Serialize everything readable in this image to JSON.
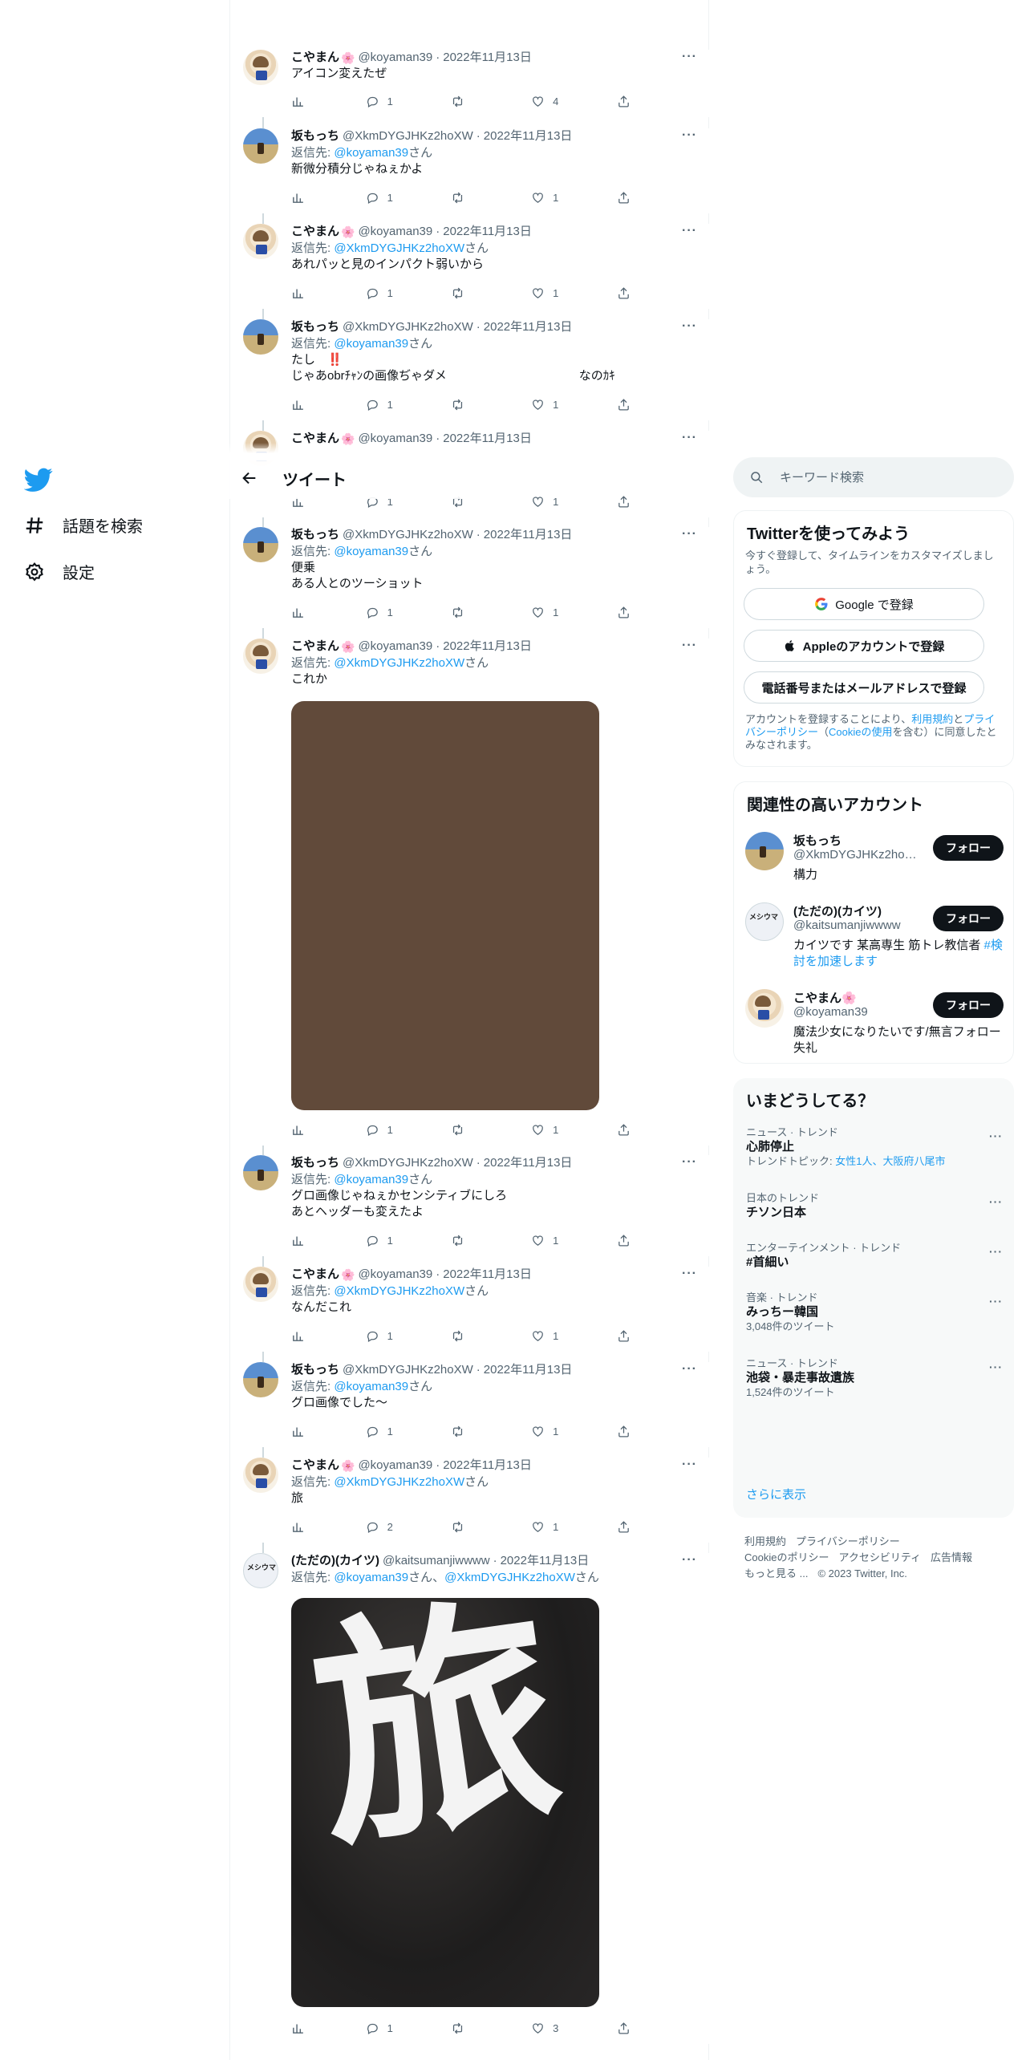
{
  "app": {
    "brand_color": "#1d9bf0"
  },
  "nav": {
    "logo": "twitter-bird-icon",
    "explore_label": "話題を検索",
    "settings_label": "設定"
  },
  "header": {
    "title": "ツイート"
  },
  "tweets": [
    {
      "name": "こやまん",
      "flower": "🌸",
      "handle": "@koyaman39",
      "date": "2022年11月13日",
      "reply_prefix": "",
      "reply_to": "",
      "reply_suffix": "",
      "text": "アイコン変えたぜ",
      "replies": "1",
      "retweets": "",
      "likes": "4"
    },
    {
      "name": "坂もっち",
      "flower": "",
      "handle": "@XkmDYGJHKz2hoXW",
      "date": "2022年11月13日",
      "reply_prefix": "返信先: ",
      "reply_to": "@koyaman39",
      "reply_suffix": "さん",
      "text": "新微分積分じゃねぇかよ",
      "replies": "1",
      "retweets": "",
      "likes": "1"
    },
    {
      "name": "こやまん",
      "flower": "🌸",
      "handle": "@koyaman39",
      "date": "2022年11月13日",
      "reply_prefix": "返信先: ",
      "reply_to": "@XkmDYGJHKz2hoXW",
      "reply_suffix": "さん",
      "text": "あれパッと見のインパクト弱いから",
      "replies": "1",
      "retweets": "",
      "likes": "1"
    },
    {
      "name": "坂もっち",
      "flower": "",
      "handle": "@XkmDYGJHKz2hoXW",
      "date": "2022年11月13日",
      "reply_prefix": "返信先: ",
      "reply_to": "@koyaman39",
      "reply_suffix": "さん",
      "text": "たし　‼️\nじゃあobrﾁｬﾝの画像ぢゃダメ　　　　　　　　　　　なのｶｷ",
      "replies": "1",
      "retweets": "",
      "likes": "1"
    },
    {
      "name": "こやまん",
      "flower": "🌸",
      "handle": "@koyaman39",
      "date": "2022年11月13日",
      "reply_prefix": "",
      "reply_to": "",
      "reply_suffix": "",
      "text": "",
      "replies": "1",
      "retweets": "",
      "likes": "1"
    },
    {
      "name": "坂もっち",
      "flower": "",
      "handle": "@XkmDYGJHKz2hoXW",
      "date": "2022年11月13日",
      "reply_prefix": "返信先: ",
      "reply_to": "@koyaman39",
      "reply_suffix": "さん",
      "text": "便乗\nある人とのツーショット",
      "replies": "1",
      "retweets": "",
      "likes": "1"
    },
    {
      "name": "こやまん",
      "flower": "🌸",
      "handle": "@koyaman39",
      "date": "2022年11月13日",
      "reply_prefix": "返信先: ",
      "reply_to": "@XkmDYGJHKz2hoXW",
      "reply_suffix": "さん",
      "text": "これか",
      "replies": "1",
      "retweets": "",
      "likes": "1"
    },
    {
      "name": "坂もっち",
      "flower": "",
      "handle": "@XkmDYGJHKz2hoXW",
      "date": "2022年11月13日",
      "reply_prefix": "返信先: ",
      "reply_to": "@koyaman39",
      "reply_suffix": "さん",
      "text": "グロ画像じゃねぇかセンシティブにしろ\nあとヘッダーも変えたよ",
      "replies": "1",
      "retweets": "",
      "likes": "1"
    },
    {
      "name": "こやまん",
      "flower": "🌸",
      "handle": "@koyaman39",
      "date": "2022年11月13日",
      "reply_prefix": "返信先: ",
      "reply_to": "@XkmDYGJHKz2hoXW",
      "reply_suffix": "さん",
      "text": "なんだこれ",
      "replies": "1",
      "retweets": "",
      "likes": "1"
    },
    {
      "name": "坂もっち",
      "flower": "",
      "handle": "@XkmDYGJHKz2hoXW",
      "date": "2022年11月13日",
      "reply_prefix": "返信先: ",
      "reply_to": "@koyaman39",
      "reply_suffix": "さん",
      "text": "グロ画像でした〜",
      "replies": "1",
      "retweets": "",
      "likes": "1"
    },
    {
      "name": "こやまん",
      "flower": "🌸",
      "handle": "@koyaman39",
      "date": "2022年11月13日",
      "reply_prefix": "返信先: ",
      "reply_to": "@XkmDYGJHKz2hoXW",
      "reply_suffix": "さん",
      "text": "旅",
      "replies": "2",
      "retweets": "",
      "likes": "1"
    },
    {
      "name": "(ただの)(カイツ)",
      "flower": "",
      "handle": "@kaitsumanjiwwww",
      "date": "2022年11月13日",
      "reply_prefix": "返信先: ",
      "reply_to": "@koyaman39",
      "reply_suffix": "さん、",
      "reply_to2": "@XkmDYGJHKz2hoXW",
      "reply_suffix2": "さん",
      "text": "",
      "replies": "1",
      "retweets": "",
      "likes": "3",
      "image_text": "旅"
    }
  ],
  "search": {
    "placeholder": "キーワード検索"
  },
  "signup": {
    "title": "Twitterを使ってみよう",
    "subtitle": "今すぐ登録して、タイムラインをカスタマイズしましょう。",
    "google": "Google で登録",
    "apple": "Appleのアカウントで登録",
    "phone": "電話番号またはメールアドレスで登録",
    "legal_1": "アカウントを登録することにより、",
    "legal_terms": "利用規約",
    "legal_2": "と",
    "legal_privacy": "プライバシーポリシー",
    "legal_3": "（",
    "legal_cookie": "Cookieの使用",
    "legal_4": "を含む）に同意したとみなされます。"
  },
  "related": {
    "title": "関連性の高いアカウント",
    "follow_label": "フォロー",
    "accounts": [
      {
        "name": "坂もっち",
        "handle": "@XkmDYGJHKz2hoXW",
        "bio": "構力",
        "bio_link": ""
      },
      {
        "name": "(ただの)(カイツ)",
        "handle": "@kaitsumanjiwwww",
        "bio": "カイツです 某高専生 筋トレ教信者 ",
        "bio_link": "#検討を加速します"
      },
      {
        "name": "こやまん🌸",
        "handle": "@koyaman39",
        "bio": "魔法少女になりたいです/無言フォロー失礼",
        "bio_link": ""
      }
    ]
  },
  "trends": {
    "title": "いまどうしてる？",
    "items": [
      {
        "category": "ニュース · トレンド",
        "topic": "心肺停止",
        "meta_prefix": "トレンドトピック: ",
        "meta_link": "女性1人、大阪府八尾市",
        "meta": ""
      },
      {
        "category": "日本のトレンド",
        "topic": "チソン日本",
        "meta_prefix": "",
        "meta_link": "",
        "meta": ""
      },
      {
        "category": "エンターテインメント · トレンド",
        "topic": "#首細い",
        "meta_prefix": "",
        "meta_link": "",
        "meta": ""
      },
      {
        "category": "音楽 · トレンド",
        "topic": "みっちー韓国",
        "meta_prefix": "",
        "meta_link": "",
        "meta": "3,048件のツイート"
      },
      {
        "category": "ニュース · トレンド",
        "topic": "池袋・暴走事故遺族",
        "meta_prefix": "",
        "meta_link": "",
        "meta": "1,524件のツイート"
      }
    ],
    "show_more": "さらに表示"
  },
  "footer": {
    "terms": "利用規約",
    "privacy": "プライバシーポリシー",
    "cookie": "Cookieのポリシー",
    "accessibility": "アクセシビリティ",
    "ads": "広告情報",
    "more": "もっと見る ...",
    "copyright": "© 2023 Twitter, Inc."
  }
}
